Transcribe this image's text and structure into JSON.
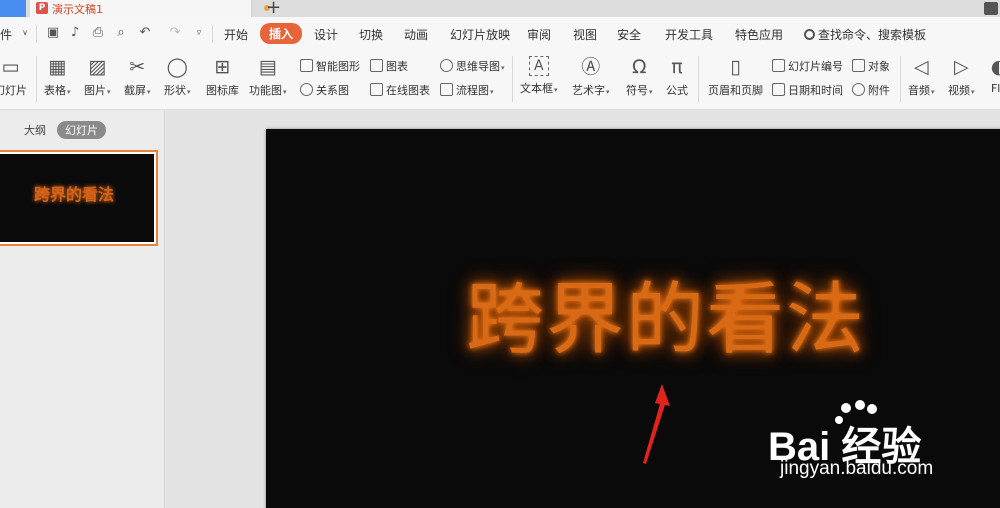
{
  "tabbar": {
    "doc_icon": "P",
    "doc_name": "演示文稿1",
    "new_tab": "+"
  },
  "menu": {
    "file": "文件",
    "items": [
      "开始",
      "插入",
      "设计",
      "切换",
      "动画",
      "幻灯片放映",
      "审阅",
      "视图",
      "安全",
      "开发工具",
      "特色应用"
    ],
    "active_item": "插入",
    "search": "查找命令、搜索模板"
  },
  "ribbon": {
    "new_slide": "幻灯片",
    "table": "表格",
    "picture": "图片",
    "screenshot": "截屏",
    "shape": "形状",
    "icon_lib": "图标库",
    "func_chart": "功能图",
    "smart_shape": "智能图形",
    "chart": "图表",
    "mind_map": "思维导图",
    "relation": "关系图",
    "online_chart": "在线图表",
    "flow_chart": "流程图",
    "text_box": "文本框",
    "word_art": "艺术字",
    "symbol": "符号",
    "formula": "公式",
    "header_footer": "页眉和页脚",
    "slide_number": "幻灯片编号",
    "object": "对象",
    "date_time": "日期和时间",
    "attachment": "附件",
    "audio": "音频",
    "video": "视频",
    "flash": "Fla"
  },
  "left_panel": {
    "outline_tab": "大纲",
    "slides_tab": "幻灯片",
    "thumb_title": "跨界的看法"
  },
  "slide": {
    "title": "跨界的看法",
    "title_color": "#d86a16",
    "background": "#0a0a0a"
  },
  "watermark": {
    "logo_text": "Bai  经验",
    "url": "jingyan.baidu.com"
  },
  "colors": {
    "accent": "#e8643a",
    "tab_blue": "#4a8df0",
    "annotation": "#e0231b"
  }
}
